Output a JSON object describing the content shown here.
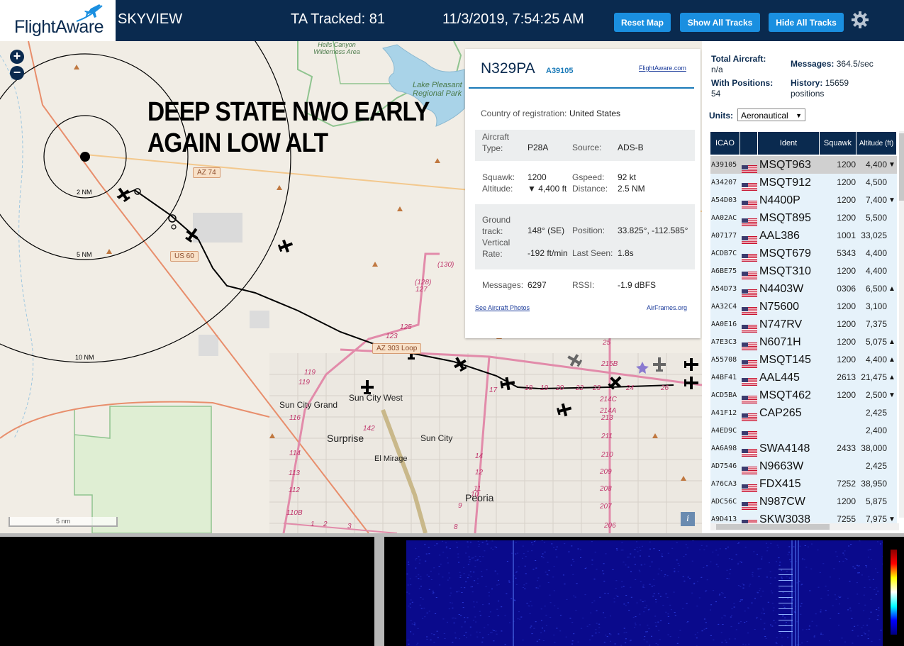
{
  "header": {
    "logo_text": "FlightAware",
    "site_name": "SKYVIEW",
    "tracked": "TA Tracked: 81",
    "datetime": "11/3/2019, 7:54:25 AM",
    "buttons": {
      "reset": "Reset Map",
      "show_all": "Show All Tracks",
      "hide_all": "Hide All Tracks"
    },
    "settings_icon": "gear-icon"
  },
  "map": {
    "overlay_text": [
      "DEEP STATE NWO EARLY",
      "AGAIN LOW ALT"
    ],
    "zoom_in": "+",
    "zoom_out": "−",
    "ring_labels": [
      "2 NM",
      "5 NM",
      "10 NM"
    ],
    "places": [
      "Sun City Grand",
      "Sun City West",
      "Surprise",
      "Sun City",
      "El Mirage",
      "Peoria",
      "Lake Pleasant Regional Park",
      "Hells Canyon Wilderness Area"
    ],
    "shields": [
      "AZ 74",
      "US 60",
      "AZ 303 Loop"
    ],
    "road_numbers": [
      "(130)",
      "(128)",
      "127",
      "125",
      "123",
      "119",
      "119",
      "116",
      "114",
      "113",
      "112",
      "110B",
      "142",
      "14",
      "12",
      "11",
      "10",
      "9",
      "8",
      "1",
      "2",
      "3",
      "17",
      "18",
      "19",
      "20",
      "22",
      "23",
      "24",
      "26",
      "25",
      "215B",
      "214C",
      "214A",
      "213",
      "211",
      "210",
      "209",
      "208",
      "207",
      "206"
    ],
    "scale_label": "5 nm",
    "info_icon": "i"
  },
  "popup": {
    "ident": "N329PA",
    "hex": "A39105",
    "fa_link": "FlightAware.com",
    "country_label": "Country of registration:",
    "country": "United States",
    "aircraft_type_label": "Aircraft Type:",
    "aircraft_type": "P28A",
    "source_label": "Source:",
    "source": "ADS-B",
    "squawk_label": "Squawk:",
    "squawk": "1200",
    "gspeed_label": "Gspeed:",
    "gspeed": "92 kt",
    "altitude_label": "Altitude:",
    "altitude": "▼ 4,400 ft",
    "distance_label": "Distance:",
    "distance": "2.5 NM",
    "track_label": "Ground track:",
    "track": "148° (SE)",
    "position_label": "Position:",
    "position": "33.825°, -112.585°",
    "vrate_label": "Vertical Rate:",
    "vrate": "-192 ft/min",
    "lastseen_label": "Last Seen:",
    "lastseen": "1.8s",
    "messages_label": "Messages:",
    "messages": "6297",
    "rssi_label": "RSSI:",
    "rssi": "-1.9 dBFS",
    "photos_link": "See Aircraft Photos",
    "airframes_link": "AirFrames.org"
  },
  "panel": {
    "total_label": "Total Aircraft:",
    "total_value": "n/a",
    "messages_label": "Messages:",
    "messages_value": "364.5/sec",
    "withpos_label": "With Positions:",
    "withpos_value": "54",
    "history_label": "History:",
    "history_value": "15659 positions",
    "units_label": "Units:",
    "units_value": "Aeronautical",
    "columns": [
      "ICAO",
      "Ident",
      "Squawk",
      "Altitude (ft)"
    ],
    "rows": [
      {
        "icao": "A39105",
        "ident": "MSQT963",
        "squawk": "1200",
        "alt": "4,400",
        "trend": "▼",
        "selected": true
      },
      {
        "icao": "A34207",
        "ident": "MSQT912",
        "squawk": "1200",
        "alt": "4,500",
        "trend": ""
      },
      {
        "icao": "A54D03",
        "ident": "N4400P",
        "squawk": "1200",
        "alt": "7,400",
        "trend": "▼"
      },
      {
        "icao": "AA02AC",
        "ident": "MSQT895",
        "squawk": "1200",
        "alt": "5,500",
        "trend": ""
      },
      {
        "icao": "A07177",
        "ident": "AAL386",
        "squawk": "1001",
        "alt": "33,025",
        "trend": ""
      },
      {
        "icao": "ACDB7C",
        "ident": "MSQT679",
        "squawk": "5343",
        "alt": "4,400",
        "trend": ""
      },
      {
        "icao": "A6BE75",
        "ident": "MSQT310",
        "squawk": "1200",
        "alt": "4,400",
        "trend": ""
      },
      {
        "icao": "A54D73",
        "ident": "N4403W",
        "squawk": "0306",
        "alt": "6,500",
        "trend": "▲"
      },
      {
        "icao": "AA32C4",
        "ident": "N75600",
        "squawk": "1200",
        "alt": "3,100",
        "trend": ""
      },
      {
        "icao": "AA0E16",
        "ident": "N747RV",
        "squawk": "1200",
        "alt": "7,375",
        "trend": ""
      },
      {
        "icao": "A7E3C3",
        "ident": "N6071H",
        "squawk": "1200",
        "alt": "5,075",
        "trend": "▲"
      },
      {
        "icao": "A55708",
        "ident": "MSQT145",
        "squawk": "1200",
        "alt": "4,400",
        "trend": "▲"
      },
      {
        "icao": "A4BF41",
        "ident": "AAL445",
        "squawk": "2613",
        "alt": "21,475",
        "trend": "▲"
      },
      {
        "icao": "ACD5BA",
        "ident": "MSQT462",
        "squawk": "1200",
        "alt": "2,500",
        "trend": "▼"
      },
      {
        "icao": "A41F12",
        "ident": "CAP265",
        "squawk": "",
        "alt": "2,425",
        "trend": ""
      },
      {
        "icao": "A4ED9C",
        "ident": "",
        "squawk": "",
        "alt": "2,400",
        "trend": ""
      },
      {
        "icao": "AA6A98",
        "ident": "SWA4148",
        "squawk": "2433",
        "alt": "38,000",
        "trend": ""
      },
      {
        "icao": "AD7546",
        "ident": "N9663W",
        "squawk": "",
        "alt": "2,425",
        "trend": ""
      },
      {
        "icao": "A76CA3",
        "ident": "FDX415",
        "squawk": "7252",
        "alt": "38,950",
        "trend": ""
      },
      {
        "icao": "ADC56C",
        "ident": "N987CW",
        "squawk": "1200",
        "alt": "5,875",
        "trend": ""
      },
      {
        "icao": "A9D413",
        "ident": "SKW3038",
        "squawk": "7255",
        "alt": "7,975",
        "trend": "▼"
      }
    ]
  },
  "colors": {
    "header_bg": "#0a2a4f",
    "button": "#1a8fe0",
    "row_bg": "#e6f2fa",
    "accent": "#1a7ab8"
  }
}
